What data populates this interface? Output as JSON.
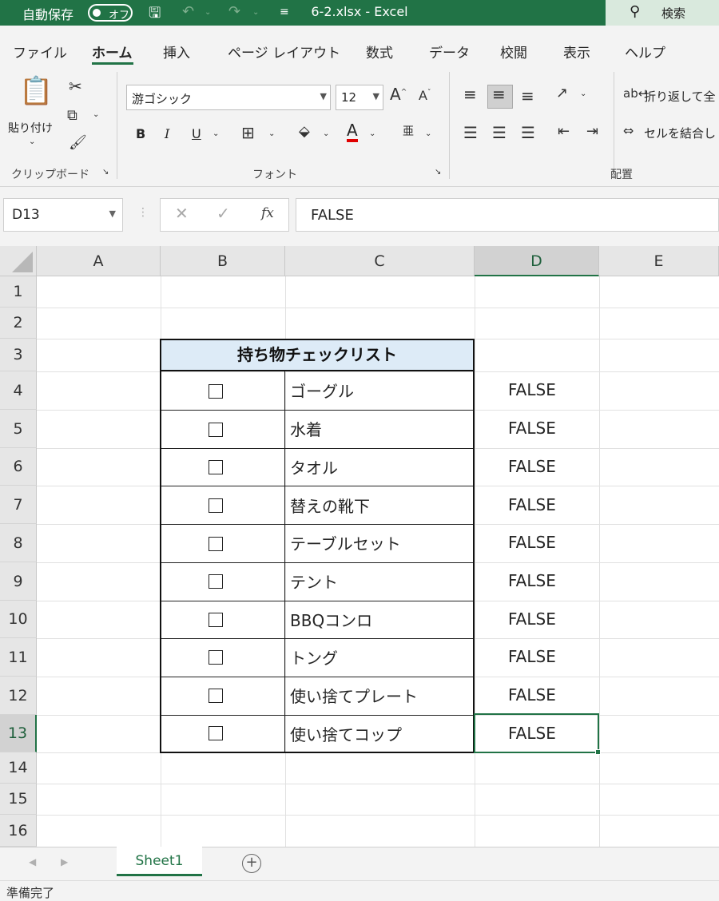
{
  "titlebar": {
    "autosave_label": "自動保存",
    "autosave_state": "オフ",
    "filename": "6-2.xlsx  -  Excel",
    "search_label": "検索"
  },
  "tabs": [
    "ファイル",
    "ホーム",
    "挿入",
    "ページ レイアウト",
    "数式",
    "データ",
    "校閲",
    "表示",
    "ヘルプ"
  ],
  "active_tab": "ホーム",
  "ribbon": {
    "paste_label": "貼り付け",
    "font_name": "游ゴシック",
    "font_size": "12",
    "bold": "B",
    "italic": "I",
    "underline": "U",
    "font_color_glyph": "A",
    "wrap_text": "折り返して全",
    "merge_cells": "セルを結合し",
    "groups": {
      "clipboard": "クリップボード",
      "font": "フォント",
      "alignment": "配置"
    }
  },
  "formula_bar": {
    "name_box": "D13",
    "fx": "fx",
    "value": "FALSE"
  },
  "sheet": {
    "columns": [
      "A",
      "B",
      "C",
      "D",
      "E"
    ],
    "selected_column": "D",
    "rows": [
      "1",
      "2",
      "3",
      "4",
      "5",
      "6",
      "7",
      "8",
      "9",
      "10",
      "11",
      "12",
      "13",
      "14",
      "15",
      "16"
    ],
    "selected_row": "13",
    "title": "持ち物チェックリスト",
    "checkbox_glyph": "☐",
    "items": [
      {
        "row": 4,
        "name": "ゴーグル",
        "d": "FALSE"
      },
      {
        "row": 5,
        "name": "水着",
        "d": "FALSE"
      },
      {
        "row": 6,
        "name": "タオル",
        "d": "FALSE"
      },
      {
        "row": 7,
        "name": "替えの靴下",
        "d": "FALSE"
      },
      {
        "row": 8,
        "name": "テーブルセット",
        "d": "FALSE"
      },
      {
        "row": 9,
        "name": "テント",
        "d": "FALSE"
      },
      {
        "row": 10,
        "name": "BBQコンロ",
        "d": "FALSE"
      },
      {
        "row": 11,
        "name": "トング",
        "d": "FALSE"
      },
      {
        "row": 12,
        "name": "使い捨てプレート",
        "d": "FALSE"
      },
      {
        "row": 13,
        "name": "使い捨てコップ",
        "d": "FALSE"
      }
    ]
  },
  "sheet_tabs": [
    "Sheet1"
  ],
  "status": "準備完了",
  "colors": {
    "accent": "#217346",
    "header_fill": "#DDEBF7"
  }
}
